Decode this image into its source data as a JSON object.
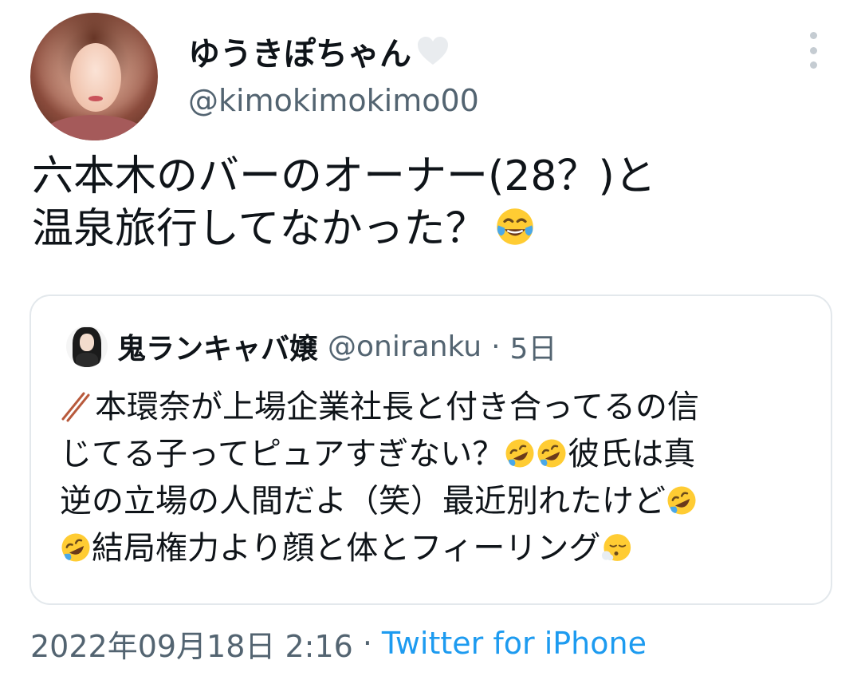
{
  "author": {
    "display_name": "ゆうきぽちゃん",
    "handle": "@kimokimokimo00",
    "badge_icon": "heart-icon"
  },
  "tweet": {
    "text_lines": [
      "六本木のバーのオーナー(28？)と",
      "温泉旅行してなかった？"
    ],
    "emoji": "face-with-tears-of-joy"
  },
  "quoted_tweet": {
    "display_name": "鬼ランキャバ嬢",
    "handle": "@oniranku",
    "separator": "·",
    "time": "5日",
    "text_lines": [
      "本環奈が上場企業社長と付き合ってるの信",
      "じてる子ってピュアすぎない？",
      "彼氏は真",
      "逆の立場の人間だよ（笑）最近別れたけど",
      "結局権力より顔と体とフィーリング"
    ],
    "emojis": [
      "chopsticks",
      "rolling-on-floor-laughing",
      "face-exhaling"
    ]
  },
  "footer": {
    "timestamp": "2022年09月18日 2:16",
    "separator": "·",
    "source": "Twitter for iPhone"
  },
  "colors": {
    "primary_text": "#0f1419",
    "secondary_text": "#536471",
    "link": "#1d9bf0",
    "border": "#e3e8ec"
  }
}
